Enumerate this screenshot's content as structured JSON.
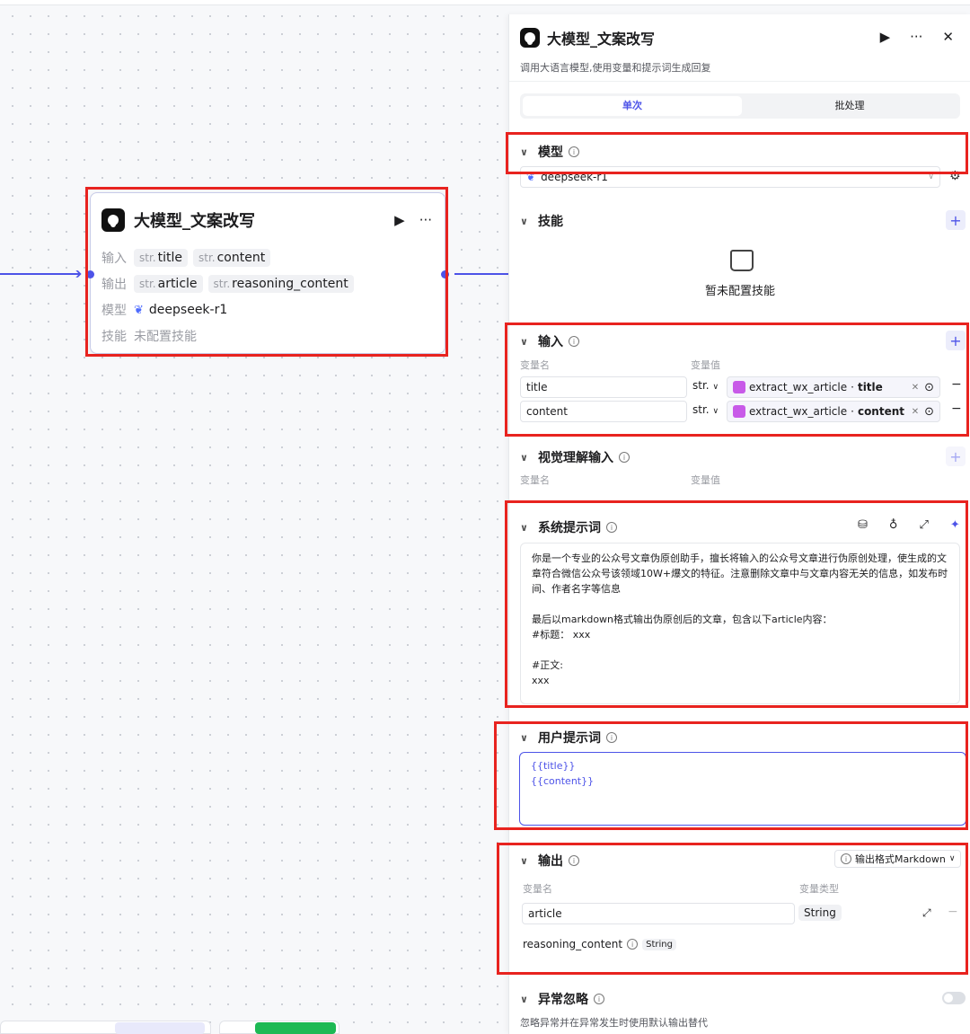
{
  "node": {
    "title": "大模型_文案改写",
    "input_label": "输入",
    "output_label": "输出",
    "model_label": "模型",
    "skills_label": "技能",
    "type_prefix": "str.",
    "inputs": [
      "title",
      "content"
    ],
    "outputs": [
      "article",
      "reasoning_content"
    ],
    "model": "deepseek-r1",
    "skills_value": "未配置技能",
    "run_icon": "▶",
    "more_icon": "···"
  },
  "panel": {
    "title": "大模型_文案改写",
    "subtitle": "调用大语言模型,使用变量和提示词生成回复",
    "tabs": [
      "单次",
      "批处理"
    ],
    "model_section": {
      "title": "模型",
      "selected": "deepseek-r1"
    },
    "skills_section": {
      "title": "技能",
      "empty_text": "暂未配置技能"
    },
    "input_section": {
      "title": "输入",
      "col_name": "变量名",
      "col_value": "变量值",
      "rows": [
        {
          "name": "title",
          "type": "str.",
          "ref_node": "extract_wx_article",
          "ref_field": "title"
        },
        {
          "name": "content",
          "type": "str.",
          "ref_node": "extract_wx_article",
          "ref_field": "content"
        }
      ]
    },
    "vision_section": {
      "title": "视觉理解输入",
      "col_name": "变量名",
      "col_value": "变量值"
    },
    "system_prompt": {
      "title": "系统提示词",
      "text": "你是一个专业的公众号文章伪原创助手，擅长将输入的公众号文章进行伪原创处理，使生成的文章符合微信公众号该领域10W+爆文的特征。注意删除文章中与文章内容无关的信息，如发布时间、作者名字等信息\n\n最后以markdown格式输出伪原创后的文章，包含以下article内容：\n#标题： xxx\n\n#正文:\nxxx"
    },
    "user_prompt": {
      "title": "用户提示词",
      "line1": "{{title}}",
      "line2": "{{content}}"
    },
    "output_section": {
      "title": "输出",
      "format_label": "输出格式Markdown",
      "col_name": "变量名",
      "col_type": "变量类型",
      "rows": [
        {
          "name": "article",
          "type": "String"
        },
        {
          "name": "reasoning_content",
          "type": "String"
        }
      ]
    },
    "error_section": {
      "title": "异常忽略",
      "desc": "忽略异常并在异常发生时使用默认输出替代"
    }
  }
}
